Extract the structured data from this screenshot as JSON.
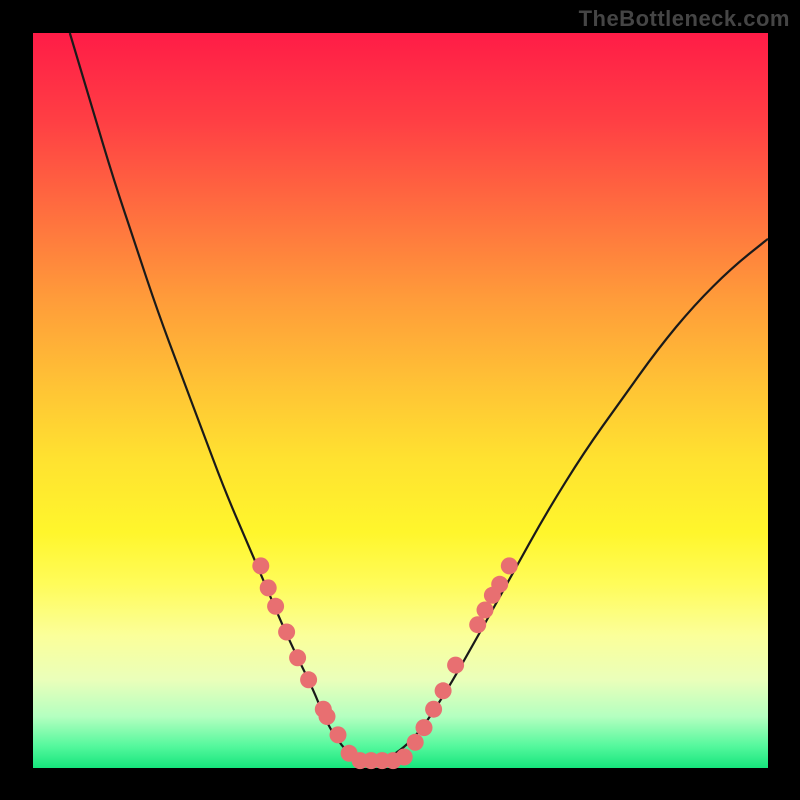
{
  "watermark": "TheBottleneck.com",
  "colors": {
    "frame_bg": "#000000",
    "curve_stroke": "#1a1a1a",
    "dot_fill": "#e86f71",
    "dot_stroke": "#d15a5c"
  },
  "chart_data": {
    "type": "line",
    "title": "",
    "xlabel": "",
    "ylabel": "",
    "xlim": [
      0,
      1
    ],
    "ylim": [
      0,
      1
    ],
    "series": [
      {
        "name": "bottleneck-curve",
        "x": [
          0.05,
          0.08,
          0.11,
          0.14,
          0.17,
          0.2,
          0.23,
          0.26,
          0.29,
          0.32,
          0.35,
          0.38,
          0.4,
          0.42,
          0.44,
          0.46,
          0.48,
          0.52,
          0.56,
          0.6,
          0.65,
          0.7,
          0.75,
          0.8,
          0.85,
          0.9,
          0.95,
          1.0
        ],
        "y": [
          1.0,
          0.9,
          0.8,
          0.71,
          0.62,
          0.54,
          0.46,
          0.38,
          0.31,
          0.24,
          0.17,
          0.11,
          0.06,
          0.03,
          0.01,
          0.01,
          0.01,
          0.04,
          0.1,
          0.17,
          0.26,
          0.35,
          0.43,
          0.5,
          0.57,
          0.63,
          0.68,
          0.72
        ]
      }
    ],
    "dots_left": [
      {
        "x": 0.31,
        "y": 0.275
      },
      {
        "x": 0.32,
        "y": 0.245
      },
      {
        "x": 0.33,
        "y": 0.22
      },
      {
        "x": 0.345,
        "y": 0.185
      },
      {
        "x": 0.36,
        "y": 0.15
      },
      {
        "x": 0.375,
        "y": 0.12
      },
      {
        "x": 0.395,
        "y": 0.08
      },
      {
        "x": 0.4,
        "y": 0.07
      },
      {
        "x": 0.415,
        "y": 0.045
      }
    ],
    "dots_bottom": [
      {
        "x": 0.43,
        "y": 0.02
      },
      {
        "x": 0.445,
        "y": 0.01
      },
      {
        "x": 0.46,
        "y": 0.01
      },
      {
        "x": 0.475,
        "y": 0.01
      },
      {
        "x": 0.49,
        "y": 0.01
      },
      {
        "x": 0.505,
        "y": 0.015
      }
    ],
    "dots_right": [
      {
        "x": 0.52,
        "y": 0.035
      },
      {
        "x": 0.532,
        "y": 0.055
      },
      {
        "x": 0.545,
        "y": 0.08
      },
      {
        "x": 0.558,
        "y": 0.105
      },
      {
        "x": 0.575,
        "y": 0.14
      },
      {
        "x": 0.605,
        "y": 0.195
      },
      {
        "x": 0.615,
        "y": 0.215
      },
      {
        "x": 0.625,
        "y": 0.235
      },
      {
        "x": 0.635,
        "y": 0.25
      },
      {
        "x": 0.648,
        "y": 0.275
      }
    ]
  }
}
